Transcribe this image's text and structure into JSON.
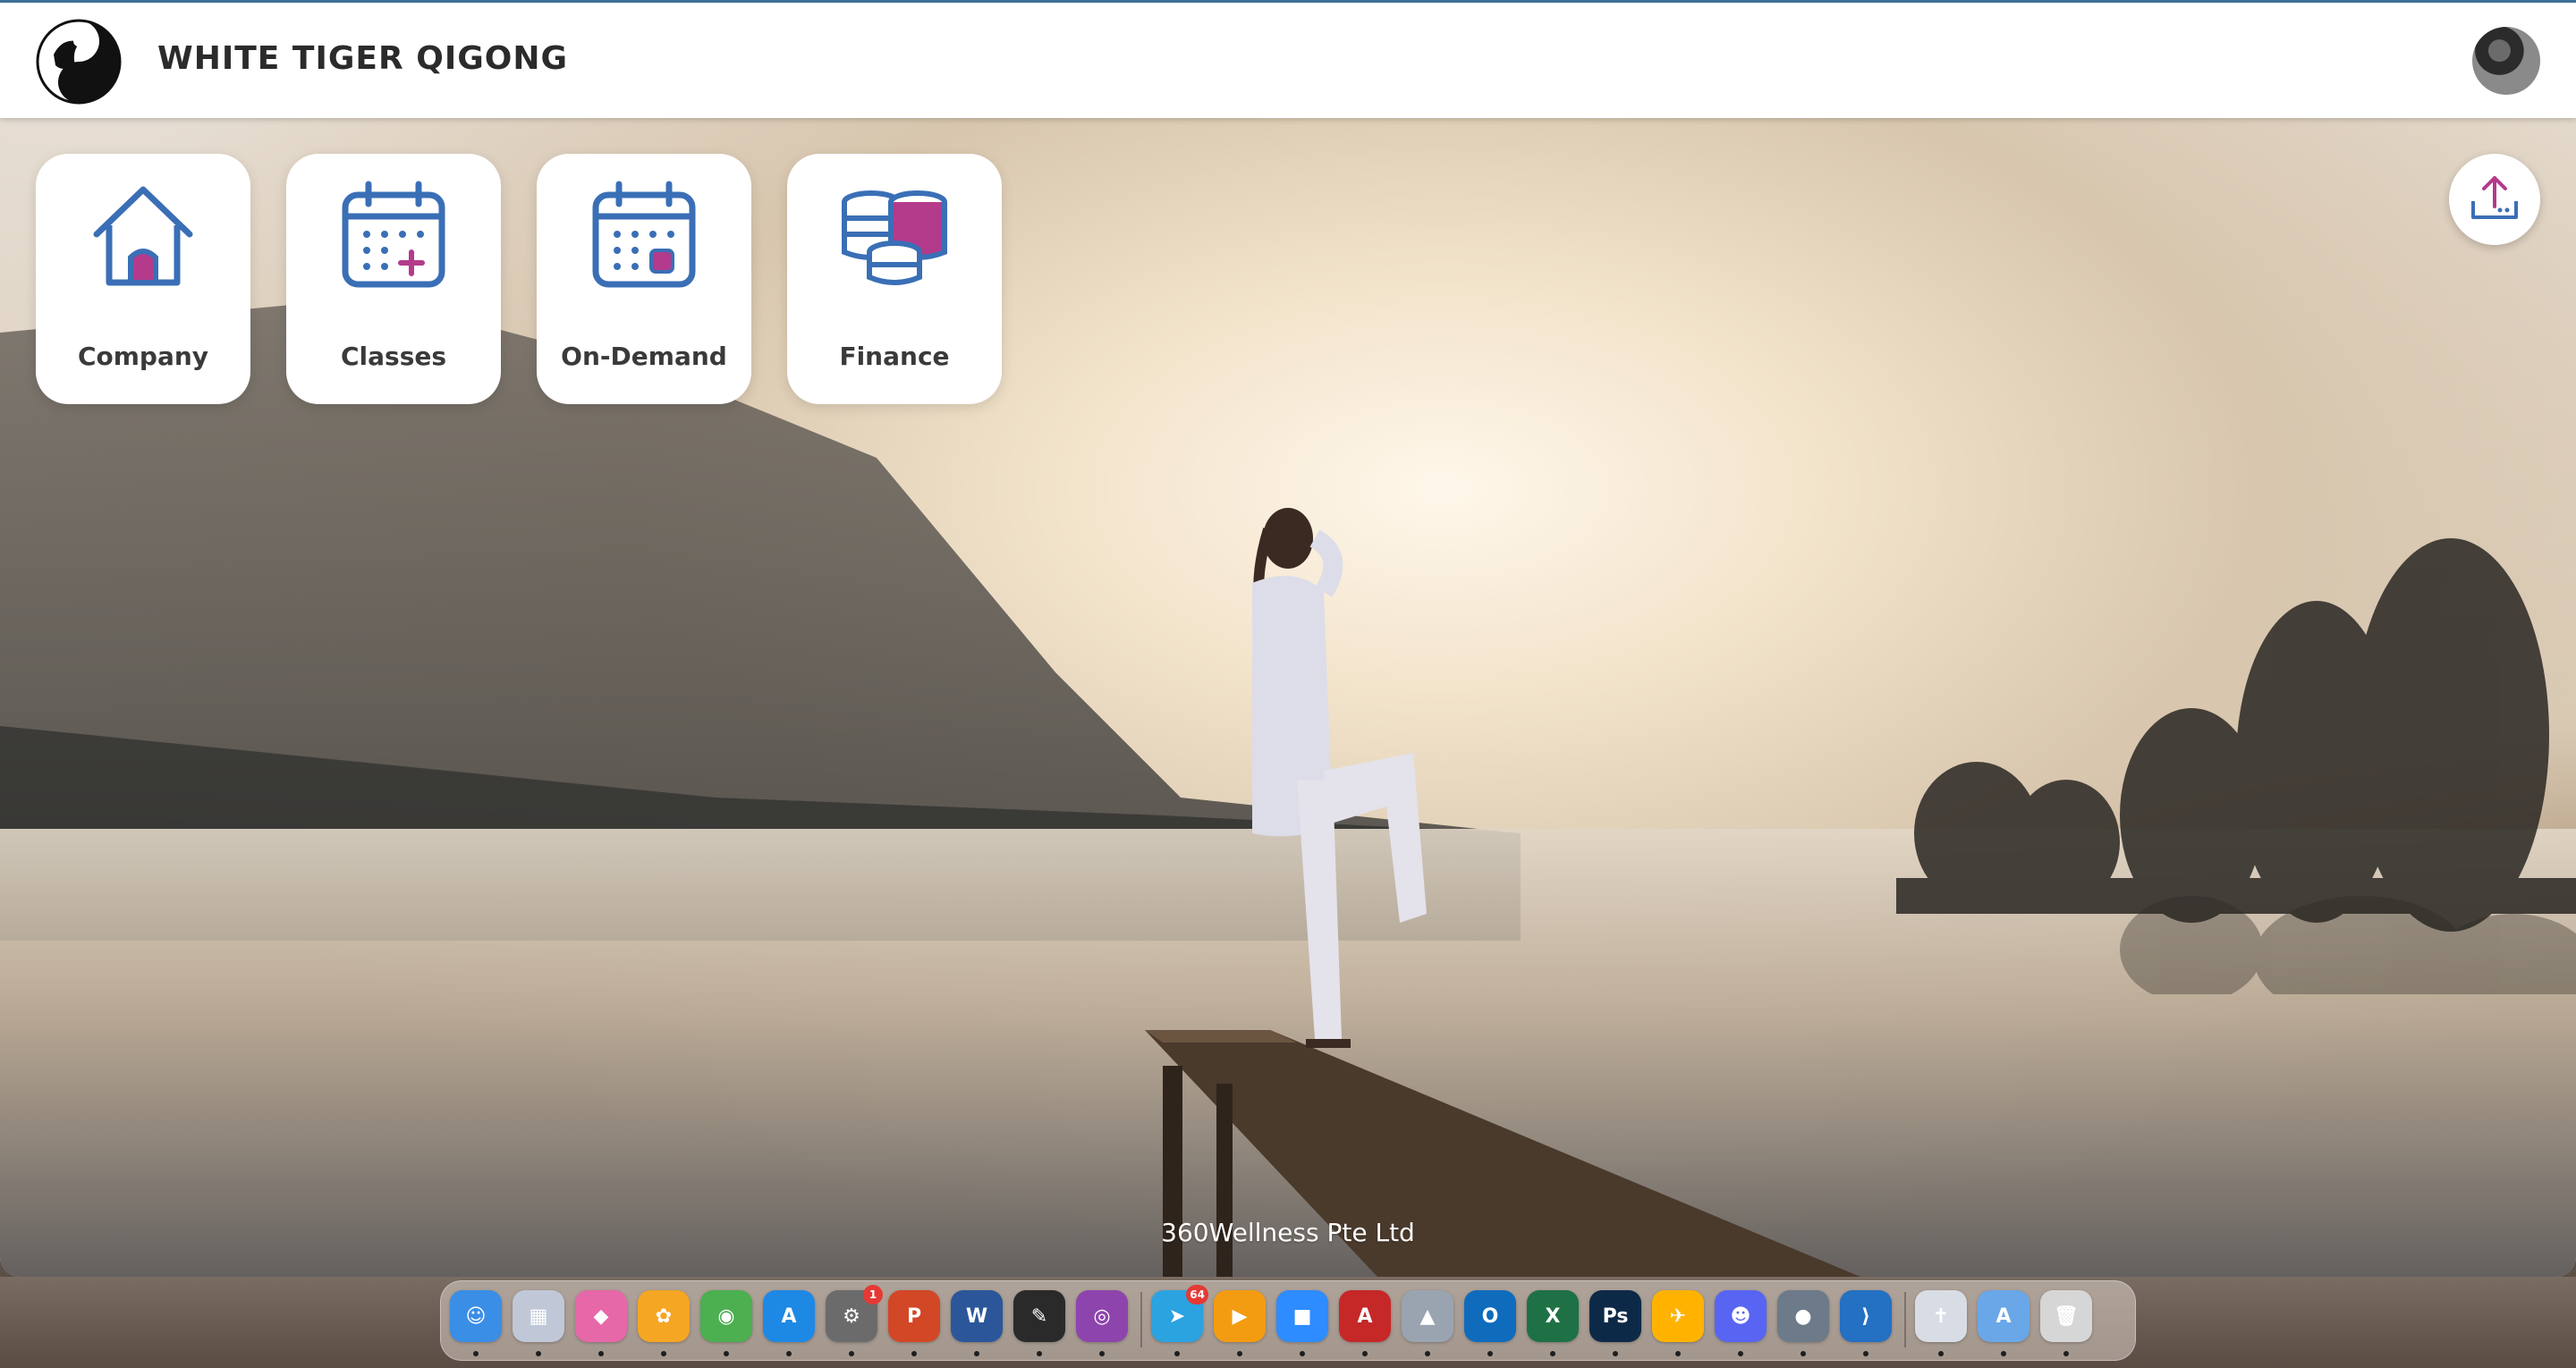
{
  "header": {
    "brand_name": "WHITE TIGER QIGONG",
    "logo_icon": "yin-yang-tiger-logo-icon",
    "avatar_icon": "user-avatar"
  },
  "tiles": [
    {
      "label": "Company",
      "icon": "house-icon"
    },
    {
      "label": "Classes",
      "icon": "calendar-plus-icon"
    },
    {
      "label": "On-Demand",
      "icon": "calendar-video-icon"
    },
    {
      "label": "Finance",
      "icon": "coins-stack-icon"
    }
  ],
  "upload": {
    "icon": "upload-icon"
  },
  "footer": {
    "text": "360Wellness Pte Ltd"
  },
  "colors": {
    "accent_blue": "#3a6fb6",
    "accent_magenta": "#b43a8c",
    "header_border": "#3e6f96"
  },
  "dock": {
    "apps": [
      {
        "name": "Finder",
        "glyph": "☺",
        "color": "#3a8ee6"
      },
      {
        "name": "Launchpad",
        "glyph": "▦",
        "color": "#c0c8d8"
      },
      {
        "name": "CleanMyMac",
        "glyph": "◆",
        "color": "#e668a8"
      },
      {
        "name": "Photos",
        "glyph": "✿",
        "color": "#f5a623"
      },
      {
        "name": "Chrome",
        "glyph": "◉",
        "color": "#4caf50"
      },
      {
        "name": "App Store",
        "glyph": "A",
        "color": "#1e88e5"
      },
      {
        "name": "System Settings",
        "glyph": "⚙",
        "color": "#6b6b6b",
        "badge": "1"
      },
      {
        "name": "PowerPoint",
        "glyph": "P",
        "color": "#d24726"
      },
      {
        "name": "Word",
        "glyph": "W",
        "color": "#2b579a"
      },
      {
        "name": "Pixelmator",
        "glyph": "✎",
        "color": "#2a2a2a"
      },
      {
        "name": "Podcasts",
        "glyph": "◎",
        "color": "#8e44ad"
      },
      {
        "name": "Telegram",
        "glyph": "➤",
        "color": "#2aa3e0",
        "badge": "64"
      },
      {
        "name": "Infuse",
        "glyph": "▶",
        "color": "#f39c12"
      },
      {
        "name": "Zoom",
        "glyph": "■",
        "color": "#2d8cff"
      },
      {
        "name": "Acrobat",
        "glyph": "A",
        "color": "#c62828"
      },
      {
        "name": "Rocket",
        "glyph": "▲",
        "color": "#9aa4b0"
      },
      {
        "name": "Outlook",
        "glyph": "O",
        "color": "#0f6cbd"
      },
      {
        "name": "Excel",
        "glyph": "X",
        "color": "#1e7145"
      },
      {
        "name": "Photoshop",
        "glyph": "Ps",
        "color": "#0c2a47"
      },
      {
        "name": "Airmail",
        "glyph": "✈",
        "color": "#ffb300"
      },
      {
        "name": "Discord",
        "glyph": "☻",
        "color": "#5865f2"
      },
      {
        "name": "Scrobbles",
        "glyph": "●",
        "color": "#6c7a8a"
      },
      {
        "name": "VS Code",
        "glyph": "⟩",
        "color": "#2470c2"
      },
      {
        "name": "Doc",
        "glyph": "✝",
        "color": "#d8dde5"
      },
      {
        "name": "Applications",
        "glyph": "A",
        "color": "#6aa7e8"
      },
      {
        "name": "Trash",
        "glyph": "🗑",
        "color": "#d6d6d6"
      }
    ]
  }
}
